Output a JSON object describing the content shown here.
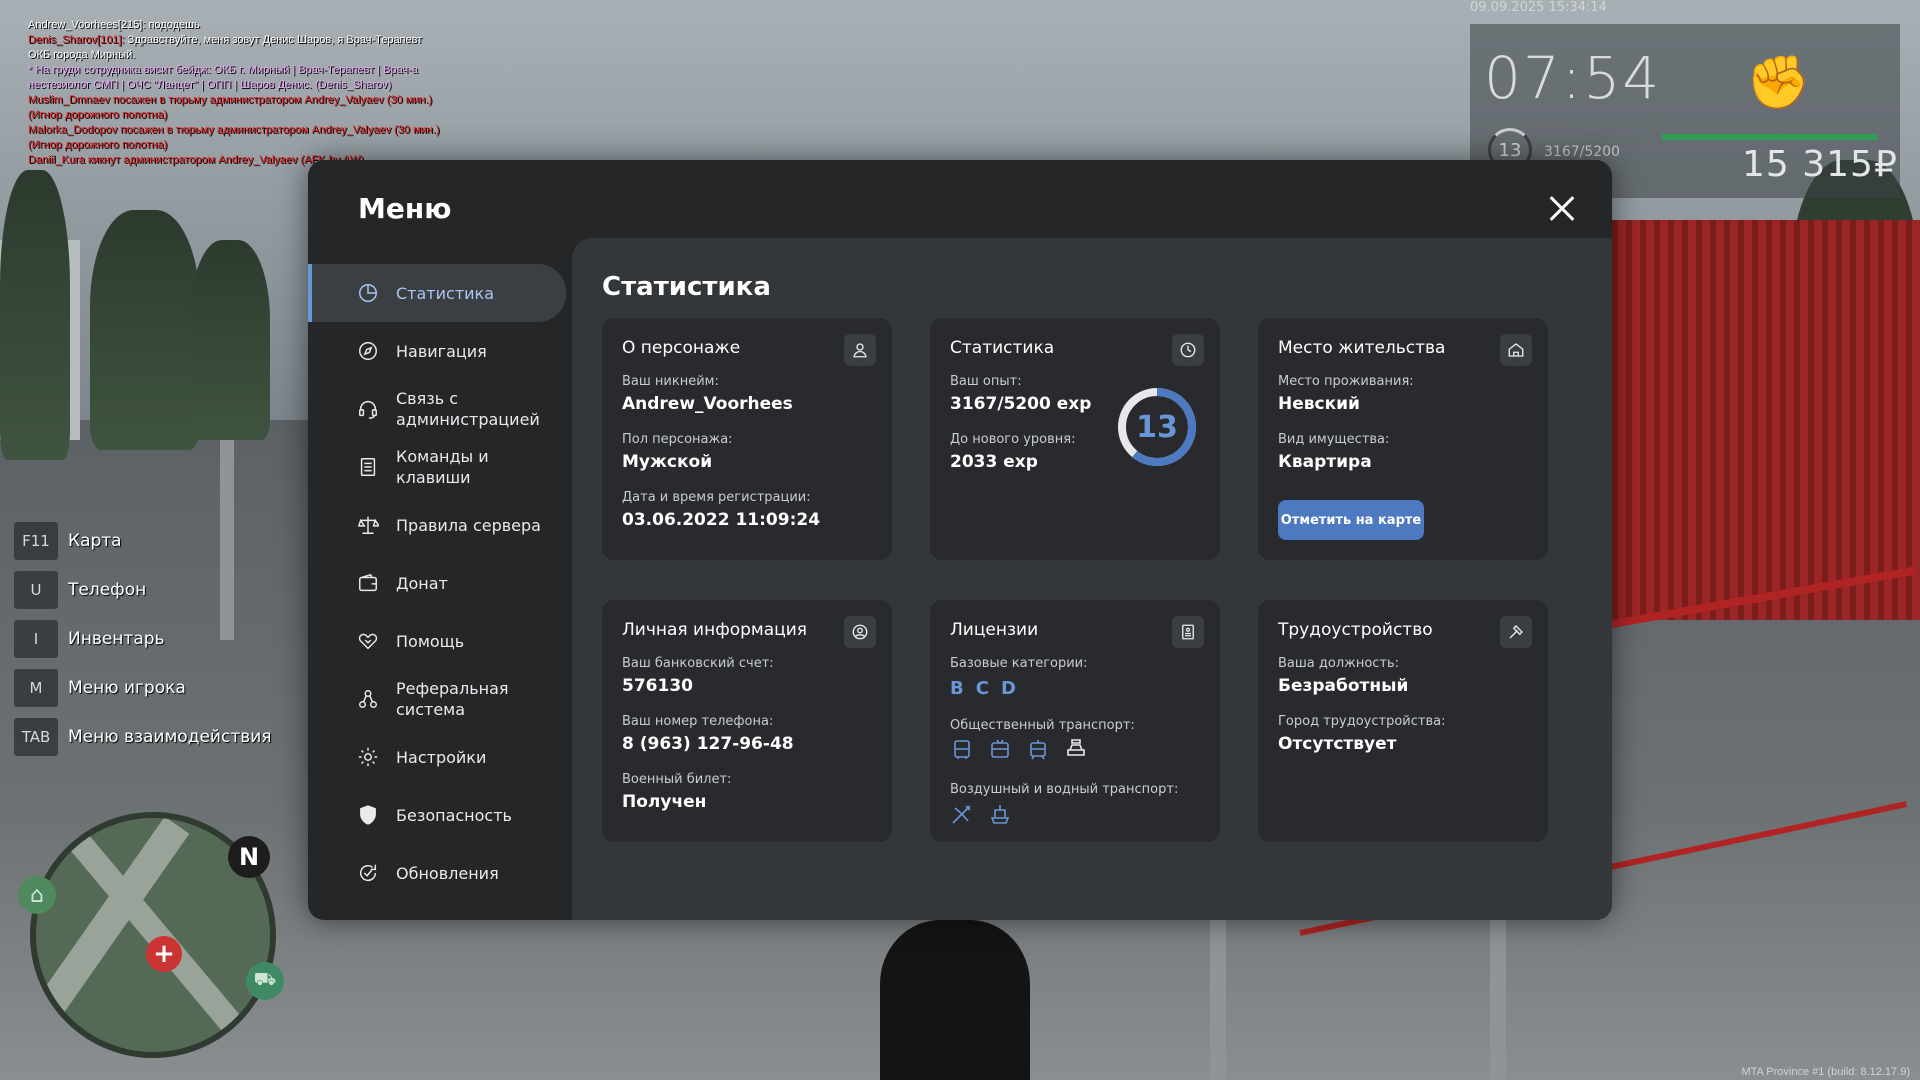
{
  "chat": [
    {
      "color": "white",
      "text": "Andrew_Voorhees[215]: пододешь"
    },
    {
      "color": "mixed",
      "name": "Denis_Sharov[101]:",
      "text": " Здравствуйте, меня зовут Денис Шаров, я Врач-Терапевт"
    },
    {
      "color": "white",
      "text": "ОКБ города Мирный."
    },
    {
      "color": "pink",
      "text": "* На груди сотрудника висит бейдж: ОКБ г. Мирный | Врач-Терапевт | Врач-а"
    },
    {
      "color": "pink",
      "text": "нестезиолог СМП | ОЧС \"Ланцет\" | ОПП | Шаров Денис. (Denis_Sharov)"
    },
    {
      "color": "red",
      "text": "Muslim_Dmnaev посажен в тюрьму администратором Andrey_Valyaev (30 мин.)"
    },
    {
      "color": "red",
      "text": "(Игнор дорожного полотна)"
    },
    {
      "color": "red",
      "text": "Malorka_Dodopov посажен в тюрьму администратором Andrey_Valyaev (30 мин.)"
    },
    {
      "color": "red",
      "text": "(Игнор дорожного полотна)"
    },
    {
      "color": "red",
      "text": "Daniil_Kura кикнут администратором Andrey_Valyaev (AFK by AW)"
    }
  ],
  "hud": {
    "date": "09.09.2025 15:34:14",
    "time": "07:54",
    "level": "13",
    "exp": "3167/5200",
    "money": "15 315₽"
  },
  "hints": [
    {
      "key": "F11",
      "label": "Карта"
    },
    {
      "key": "U",
      "label": "Телефон"
    },
    {
      "key": "I",
      "label": "Инвентарь"
    },
    {
      "key": "M",
      "label": "Меню игрока"
    },
    {
      "key": "TAB",
      "label": "Меню взаимодействия"
    }
  ],
  "minimap": {
    "north": "N"
  },
  "menu": {
    "title": "Меню",
    "nav": [
      {
        "label": "Статистика",
        "icon": "stats-icon"
      },
      {
        "label": "Навигация",
        "icon": "compass-icon"
      },
      {
        "label": "Связь с\nадминистрацией",
        "icon": "headset-icon"
      },
      {
        "label": "Команды и\nклавиши",
        "icon": "document-icon"
      },
      {
        "label": "Правила сервера",
        "icon": "scales-icon"
      },
      {
        "label": "Донат",
        "icon": "wallet-icon"
      },
      {
        "label": "Помощь",
        "icon": "handshake-icon"
      },
      {
        "label": "Реферальная\nсистема",
        "icon": "referral-icon"
      },
      {
        "label": "Настройки",
        "icon": "gear-icon"
      },
      {
        "label": "Безопасность",
        "icon": "shield-icon"
      },
      {
        "label": "Обновления",
        "icon": "refresh-icon"
      }
    ],
    "content_title": "Статистика",
    "cards": {
      "character": {
        "title": "О персонаже",
        "nick_label": "Ваш никнейм:",
        "nick": "Andrew_Voorhees",
        "gender_label": "Пол персонажа:",
        "gender": "Мужской",
        "reg_label": "Дата и время регистрации:",
        "reg": "03.06.2022 11:09:24"
      },
      "stats": {
        "title": "Статистика",
        "exp_label": "Ваш опыт:",
        "exp": "3167/5200 exp",
        "next_label": "До нового уровня:",
        "next": "2033 exp",
        "level": "13",
        "level_progress": 0.609
      },
      "residence": {
        "title": "Место жительства",
        "place_label": "Место проживания:",
        "place": "Невский",
        "prop_label": "Вид имущества:",
        "prop": "Квартира",
        "button": "Отметить на карте"
      },
      "personal": {
        "title": "Личная информация",
        "bank_label": "Ваш банковский счет:",
        "bank": "576130",
        "phone_label": "Ваш номер телефона:",
        "phone": "8 (963) 127-96-48",
        "military_label": "Военный билет:",
        "military": "Получен"
      },
      "licenses": {
        "title": "Лицензии",
        "base_label": "Базовые категории:",
        "base": [
          "B",
          "C",
          "D"
        ],
        "public_label": "Общественный транспорт:",
        "air_label": "Воздушный и водный транспорт:"
      },
      "employment": {
        "title": "Трудоустройство",
        "pos_label": "Ваша должность:",
        "pos": "Безработный",
        "city_label": "Город трудоустройства:",
        "city": "Отсутствует"
      }
    }
  },
  "build": "MTA Province #1 (build: 8.12.17.9)",
  "colors": {
    "accent": "#6a96d8",
    "button": "#4c79c0",
    "panel": "#242628",
    "content": "#34373a",
    "card": "#282a2d"
  }
}
